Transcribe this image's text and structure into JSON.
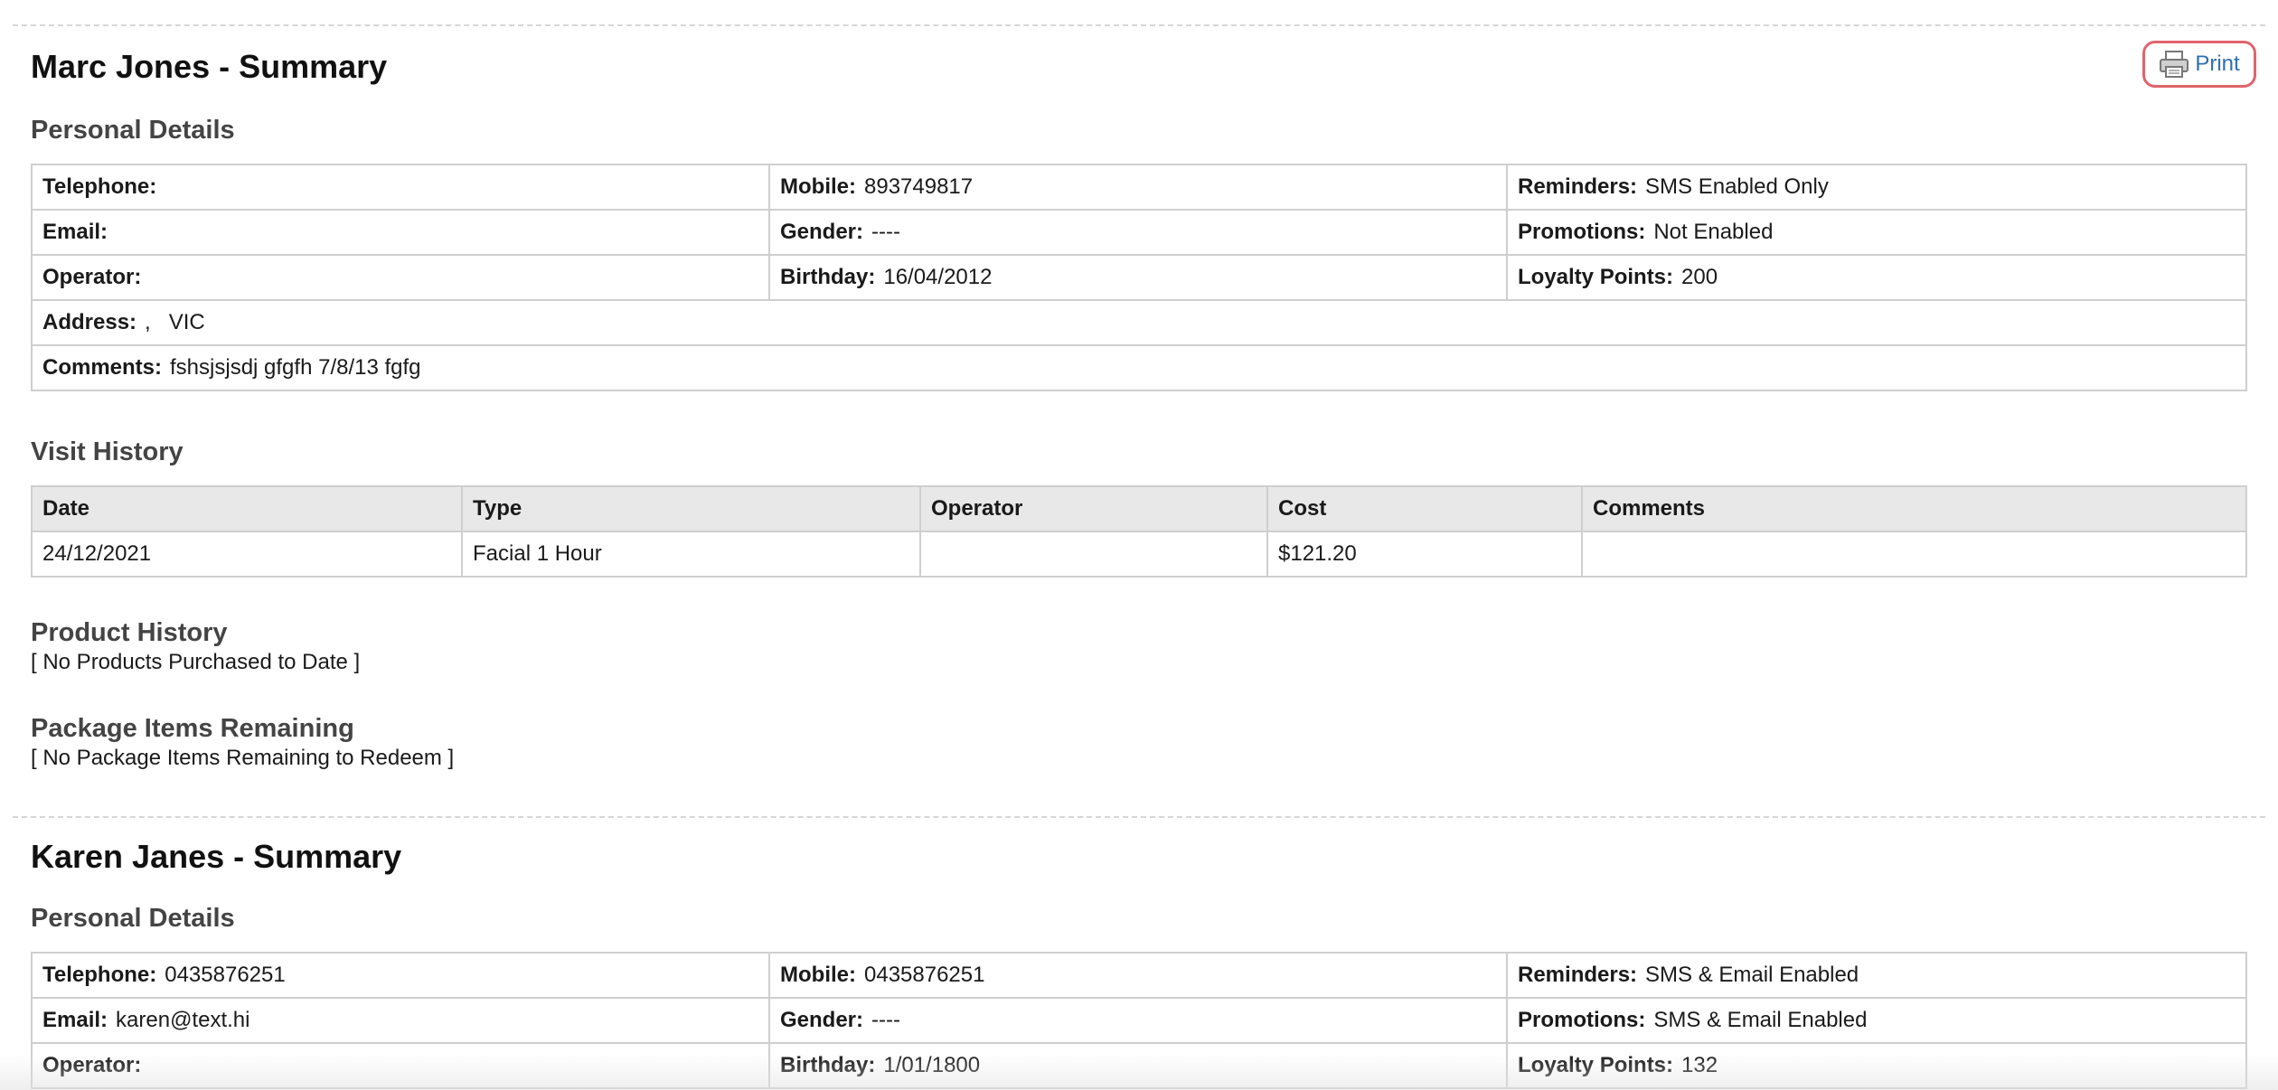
{
  "print_label": "Print",
  "icons": {
    "print": "printer-icon"
  },
  "colors": {
    "link": "#2f6fb0",
    "print_highlight": "#e0646c",
    "header_bg": "#e8e8e8"
  },
  "summaries": [
    {
      "title": "Marc Jones - Summary",
      "personal_title": "Personal Details",
      "personal": {
        "telephone_label": "Telephone:",
        "telephone": "",
        "mobile_label": "Mobile:",
        "mobile": "893749817",
        "reminders_label": "Reminders:",
        "reminders": "SMS Enabled Only",
        "email_label": "Email:",
        "email": "",
        "gender_label": "Gender:",
        "gender": "----",
        "promotions_label": "Promotions:",
        "promotions": "Not Enabled",
        "operator_label": "Operator:",
        "operator": "",
        "birthday_label": "Birthday:",
        "birthday": "16/04/2012",
        "loyalty_label": "Loyalty Points:",
        "loyalty": "200",
        "address_label": "Address:",
        "address": ",   VIC",
        "comments_label": "Comments:",
        "comments": "fshsjsjsdj gfgfh 7/8/13 fgfg"
      },
      "visit_title": "Visit History",
      "visit_headers": [
        "Date",
        "Type",
        "Operator",
        "Cost",
        "Comments"
      ],
      "visits": [
        {
          "date": "24/12/2021",
          "type": "Facial 1 Hour",
          "operator": "",
          "cost": "$121.20",
          "comments": ""
        }
      ],
      "product_title": "Product History",
      "product_note": "[ No Products Purchased to Date ]",
      "package_title": "Package Items Remaining",
      "package_note": "[ No Package Items Remaining to Redeem ]"
    },
    {
      "title": "Karen Janes - Summary",
      "personal_title": "Personal Details",
      "personal": {
        "telephone_label": "Telephone:",
        "telephone": "0435876251",
        "mobile_label": "Mobile:",
        "mobile": "0435876251",
        "reminders_label": "Reminders:",
        "reminders": "SMS & Email Enabled",
        "email_label": "Email:",
        "email": "karen@text.hi",
        "gender_label": "Gender:",
        "gender": "----",
        "promotions_label": "Promotions:",
        "promotions": "SMS & Email Enabled",
        "operator_label": "Operator:",
        "operator": "",
        "birthday_label": "Birthday:",
        "birthday": "1/01/1800",
        "loyalty_label": "Loyalty Points:",
        "loyalty": "132"
      }
    }
  ]
}
